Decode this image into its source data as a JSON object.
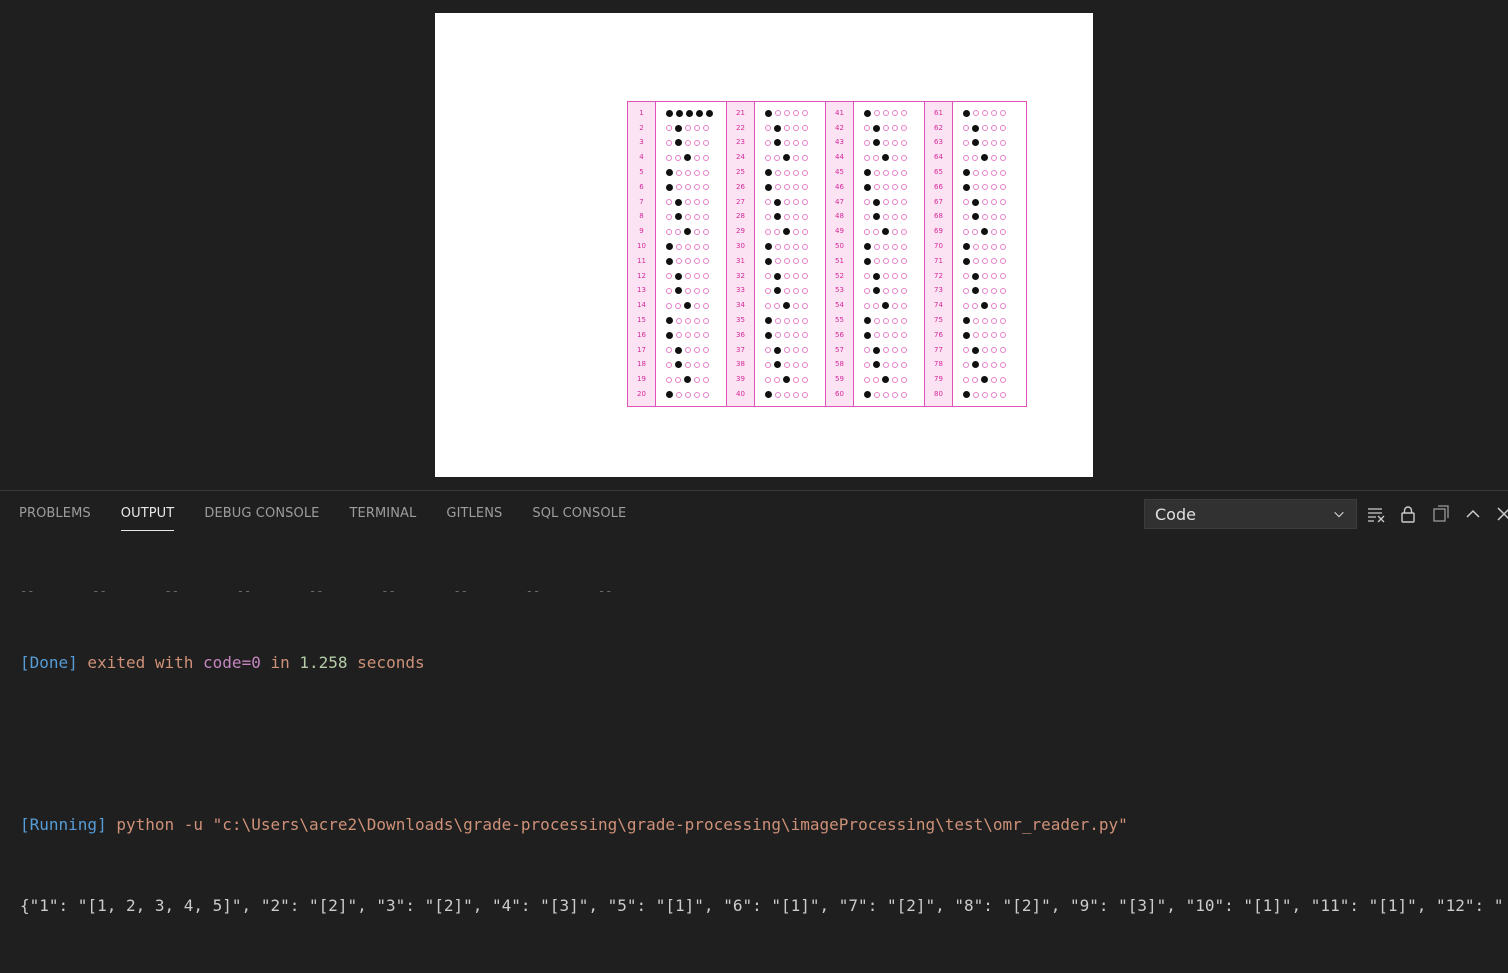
{
  "panel": {
    "tabs": [
      "PROBLEMS",
      "OUTPUT",
      "DEBUG CONSOLE",
      "TERMINAL",
      "GITLENS",
      "SQL CONSOLE"
    ],
    "active_tab": "OUTPUT",
    "output_channel": "Code"
  },
  "output": {
    "truncated_prev": "--        --        --        --        --        --        --        --        --",
    "done_tag": "[Done]",
    "done_text_1": " exited with ",
    "done_code": "code=0",
    "done_text_2": " in ",
    "done_time": "1.258",
    "done_text_3": " seconds",
    "running_tag": "[Running]",
    "running_cmd": " python -u \"c:\\Users\\acre2\\Downloads\\grade-processing\\grade-processing\\imageProcessing\\test\\omr_reader.py\"",
    "json_line": "{\"1\": \"[1, 2, 3, 4, 5]\", \"2\": \"[2]\", \"3\": \"[2]\", \"4\": \"[3]\", \"5\": \"[1]\", \"6\": \"[1]\", \"7\": \"[2]\", \"8\": \"[2]\", \"9\": \"[3]\", \"10\": \"[1]\", \"11\": \"[1]\", \"12\": \""
  },
  "sheet": {
    "columns": [
      {
        "start": 1,
        "filled": [
          [
            1,
            2,
            3,
            4,
            5
          ],
          [
            2
          ],
          [
            2
          ],
          [
            3
          ],
          [
            1
          ],
          [
            1
          ],
          [
            2
          ],
          [
            2
          ],
          [
            3
          ],
          [
            1
          ],
          [
            1
          ],
          [
            2
          ],
          [
            2
          ],
          [
            3
          ],
          [
            1
          ],
          [
            1
          ],
          [
            2
          ],
          [
            2
          ],
          [
            3
          ],
          [
            1
          ]
        ]
      },
      {
        "start": 21,
        "filled": [
          [
            1
          ],
          [
            2
          ],
          [
            2
          ],
          [
            3
          ],
          [
            1
          ],
          [
            1
          ],
          [
            2
          ],
          [
            2
          ],
          [
            3
          ],
          [
            1
          ],
          [
            1
          ],
          [
            2
          ],
          [
            2
          ],
          [
            3
          ],
          [
            1
          ],
          [
            1
          ],
          [
            2
          ],
          [
            2
          ],
          [
            3
          ],
          [
            1
          ]
        ]
      },
      {
        "start": 41,
        "filled": [
          [
            1
          ],
          [
            2
          ],
          [
            2
          ],
          [
            3
          ],
          [
            1
          ],
          [
            1
          ],
          [
            2
          ],
          [
            2
          ],
          [
            3
          ],
          [
            1
          ],
          [
            1
          ],
          [
            2
          ],
          [
            2
          ],
          [
            3
          ],
          [
            1
          ],
          [
            1
          ],
          [
            2
          ],
          [
            2
          ],
          [
            3
          ],
          [
            1
          ]
        ]
      },
      {
        "start": 61,
        "filled": [
          [
            1
          ],
          [
            2
          ],
          [
            2
          ],
          [
            3
          ],
          [
            1
          ],
          [
            1
          ],
          [
            2
          ],
          [
            2
          ],
          [
            3
          ],
          [
            1
          ],
          [
            1
          ],
          [
            2
          ],
          [
            2
          ],
          [
            3
          ],
          [
            1
          ],
          [
            1
          ],
          [
            2
          ],
          [
            2
          ],
          [
            3
          ],
          [
            1
          ]
        ]
      }
    ]
  }
}
